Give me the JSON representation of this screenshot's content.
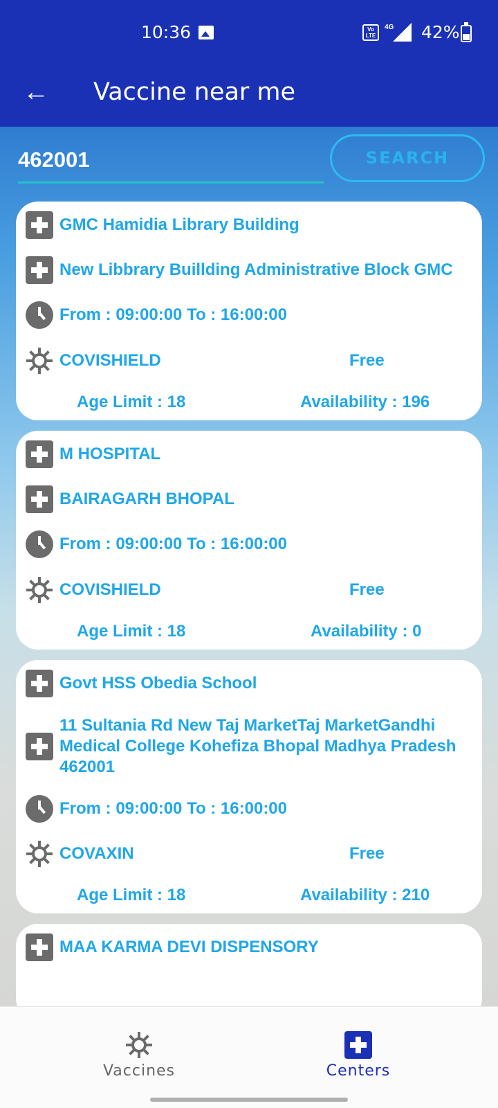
{
  "status_bar": {
    "time": "10:36",
    "network": "4G",
    "volte": "Vo LTE",
    "battery": "42%"
  },
  "app_bar": {
    "title": "Vaccine near me"
  },
  "search": {
    "value": "462001",
    "button_label": "SEARCH"
  },
  "centers": [
    {
      "name": "GMC Hamidia Library Building",
      "address": "New Libbrary Buillding Administrative Block GMC",
      "timing": "From : 09:00:00 To : 16:00:00",
      "vaccine": "COVISHIELD",
      "fee": "Free",
      "age_limit": "Age Limit : 18",
      "availability": "Availability : 196"
    },
    {
      "name": "M HOSPITAL",
      "address": "BAIRAGARH BHOPAL",
      "timing": "From : 09:00:00 To : 16:00:00",
      "vaccine": "COVISHIELD",
      "fee": "Free",
      "age_limit": "Age Limit : 18",
      "availability": "Availability : 0"
    },
    {
      "name": "Govt HSS Obedia School",
      "address": "11 Sultania Rd New Taj MarketTaj MarketGandhi Medical College Kohefiza Bhopal Madhya Pradesh 462001",
      "timing": "From : 09:00:00 To : 16:00:00",
      "vaccine": "COVAXIN",
      "fee": "Free",
      "age_limit": "Age Limit : 18",
      "availability": "Availability : 210"
    },
    {
      "name": "MAA KARMA DEVI DISPENSORY"
    }
  ],
  "bottom_nav": {
    "items": [
      {
        "label": "Vaccines",
        "icon": "virus-icon",
        "active": false
      },
      {
        "label": "Centers",
        "icon": "hospital-plus-icon",
        "active": true
      }
    ]
  },
  "colors": {
    "primary": "#1b31b5",
    "accent": "#1fa7e8",
    "icon_gray": "#6b6b6b"
  }
}
